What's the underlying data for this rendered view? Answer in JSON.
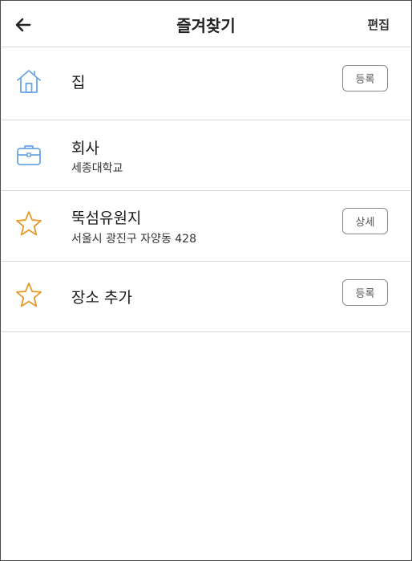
{
  "header": {
    "title": "즐겨찾기",
    "edit_label": "편집"
  },
  "favorites": [
    {
      "icon": "home-icon",
      "name": "집",
      "sub": "",
      "action": "등록"
    },
    {
      "icon": "briefcase-icon",
      "name": "회사",
      "sub": "세종대학교",
      "action": ""
    },
    {
      "icon": "star-icon",
      "name": "뚝섬유원지",
      "sub": "서울시 광진구 자양동 428",
      "action": "상세"
    },
    {
      "icon": "star-icon",
      "name": "장소 추가",
      "sub": "",
      "action": "등록"
    }
  ],
  "colors": {
    "home_icon": "#6aa6e6",
    "briefcase_icon": "#6aa6e6",
    "star_icon": "#e39a2b"
  }
}
